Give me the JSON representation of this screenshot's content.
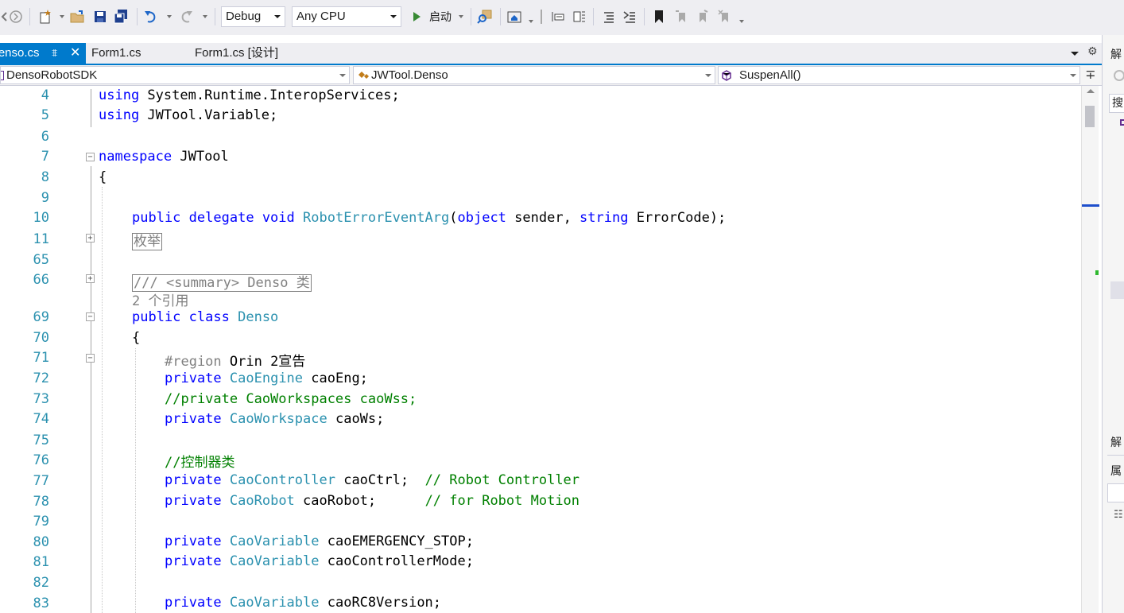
{
  "toolbar": {
    "config": "Debug",
    "platform": "Any CPU",
    "start_label": "启动"
  },
  "tabs": [
    {
      "label": "Denso.cs",
      "active": true
    },
    {
      "label": "Form1.cs",
      "active": false
    },
    {
      "label": "Form1.cs [设计]",
      "active": false
    }
  ],
  "nav": {
    "project": "DensoRobotSDK",
    "type": "JWTool.Denso",
    "member": "SuspenAll()"
  },
  "side_panel": {
    "header1": "解",
    "search": "搜",
    "header2": "解",
    "header3": "属"
  },
  "code_lines": [
    {
      "num": "4",
      "text": "using System.Runtime.InteropServices;"
    },
    {
      "num": "5",
      "text": "using JWTool.Variable;"
    },
    {
      "num": "6",
      "text": ""
    },
    {
      "num": "7",
      "text": "namespace JWTool"
    },
    {
      "num": "8",
      "text": "{"
    },
    {
      "num": "9",
      "text": ""
    },
    {
      "num": "10",
      "text": "public delegate void RobotErrorEventArg(object sender, string ErrorCode);"
    },
    {
      "num": "11",
      "text": "枚举"
    },
    {
      "num": "65",
      "text": ""
    },
    {
      "num": "66",
      "text": "/// <summary> Denso 类"
    },
    {
      "num": "",
      "text": "2 个引用"
    },
    {
      "num": "69",
      "text": "public class Denso"
    },
    {
      "num": "70",
      "text": "{"
    },
    {
      "num": "71",
      "text": "#region Orin 2宣告"
    },
    {
      "num": "72",
      "text": "private CaoEngine caoEng;"
    },
    {
      "num": "73",
      "text": "//private CaoWorkspaces caoWss;"
    },
    {
      "num": "74",
      "text": "private CaoWorkspace caoWs;"
    },
    {
      "num": "75",
      "text": ""
    },
    {
      "num": "76",
      "text": "//控制器类"
    },
    {
      "num": "77",
      "text": "private CaoController caoCtrl;  // Robot Controller"
    },
    {
      "num": "78",
      "text": "private CaoRobot caoRobot;      // for Robot Motion"
    },
    {
      "num": "79",
      "text": ""
    },
    {
      "num": "80",
      "text": "private CaoVariable caoEMERGENCY_STOP;"
    },
    {
      "num": "81",
      "text": "private CaoVariable caoControllerMode;"
    },
    {
      "num": "82",
      "text": ""
    },
    {
      "num": "83",
      "text": "private CaoVariable caoRC8Version;"
    }
  ],
  "tokens": {
    "using": "using",
    "namespace": "namespace",
    "public": "public",
    "delegate": "delegate",
    "void": "void",
    "object": "object",
    "string": "string",
    "class": "class",
    "private": "private",
    "region": "#region"
  },
  "colors": {
    "keyword": "#0000ff",
    "type": "#2b91af",
    "comment": "#008000",
    "gray": "#808080",
    "line_number": "#2b91af",
    "accent": "#007acc"
  }
}
